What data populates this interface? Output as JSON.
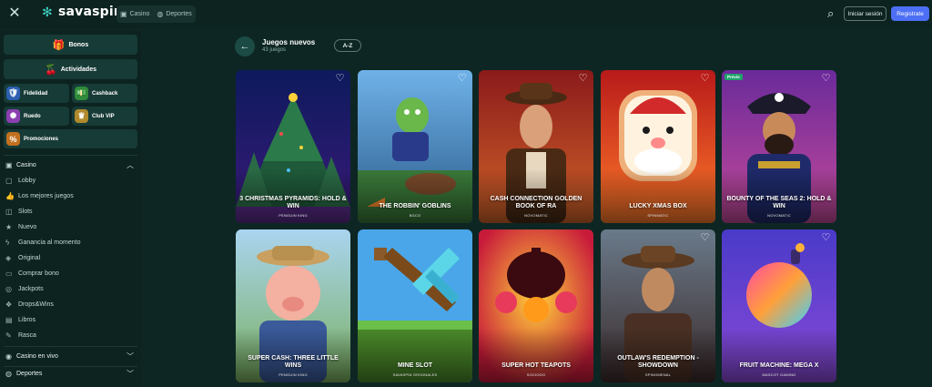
{
  "header": {
    "brand": "savaspin",
    "tabs": [
      {
        "label": "Casino",
        "icon": "casino-icon"
      },
      {
        "label": "Deportes",
        "icon": "sports-icon"
      }
    ],
    "login_label": "Iniciar sesión",
    "register_label": "Registrate"
  },
  "sidebar": {
    "promos_big": [
      {
        "label": "Bonos",
        "icon": "gift-icon"
      },
      {
        "label": "Actividades",
        "icon": "activities-icon"
      }
    ],
    "promos_small": [
      {
        "label": "Fidelidad",
        "icon": "loyalty-icon"
      },
      {
        "label": "Cashback",
        "icon": "cashback-icon"
      },
      {
        "label": "Ruedo",
        "icon": "wheel-icon"
      },
      {
        "label": "Club VIP",
        "icon": "crown-icon"
      },
      {
        "label": "Promociones",
        "icon": "promotions-icon"
      }
    ],
    "casino_section": "Casino",
    "casino_items": [
      {
        "label": "Lobby",
        "icon": "lobby-icon"
      },
      {
        "label": "Los mejores juegos",
        "icon": "thumbs-up-icon"
      },
      {
        "label": "Slots",
        "icon": "slots-icon"
      },
      {
        "label": "Nuevo",
        "icon": "star-icon"
      },
      {
        "label": "Ganancia al momento",
        "icon": "lightning-icon"
      },
      {
        "label": "Original",
        "icon": "original-icon"
      },
      {
        "label": "Comprar bono",
        "icon": "buy-bonus-icon"
      },
      {
        "label": "Jackpots",
        "icon": "jackpot-icon"
      },
      {
        "label": "Drops&Wins",
        "icon": "drops-icon"
      },
      {
        "label": "Libros",
        "icon": "book-icon"
      },
      {
        "label": "Rasca",
        "icon": "scratch-icon"
      }
    ],
    "live_section": "Casino en vivo",
    "sports_section": "Deportes"
  },
  "main": {
    "title": "Juegos nuevos",
    "count": "43 juegos",
    "sort_label": "A-Z"
  },
  "games": [
    {
      "title": "3 CHRISTMAS PYRAMIDS: HOLD & WIN",
      "provider": "PENGUIN KING",
      "badge": ""
    },
    {
      "title": "THE ROBBIN' GOBLINS",
      "provider": "BGCO",
      "badge": ""
    },
    {
      "title": "CASH CONNECTION GOLDEN BOOK OF RA",
      "provider": "NOVOMATIC",
      "badge": ""
    },
    {
      "title": "LUCKY XMAS BOX",
      "provider": "SPINMATIC",
      "badge": ""
    },
    {
      "title": "BOUNTY OF THE SEAS 2: HOLD & WIN",
      "provider": "NOVOMATIC",
      "badge": "Previo"
    },
    {
      "title": "SUPER CASH: THREE LITTLE WINS",
      "provider": "PENGUIN KING",
      "badge": ""
    },
    {
      "title": "MINE SLOT",
      "provider": "SAVASPIN ORIGINALES",
      "badge": ""
    },
    {
      "title": "SUPER HOT TEAPOTS",
      "provider": "SOCIOGO",
      "badge": ""
    },
    {
      "title": "OUTLAW'S REDEMPTION - SHOWDOWN",
      "provider": "SPINOMENAL",
      "badge": ""
    },
    {
      "title": "FRUIT MACHINE: MEGA X",
      "provider": "MASCOT GAMING",
      "badge": ""
    }
  ]
}
